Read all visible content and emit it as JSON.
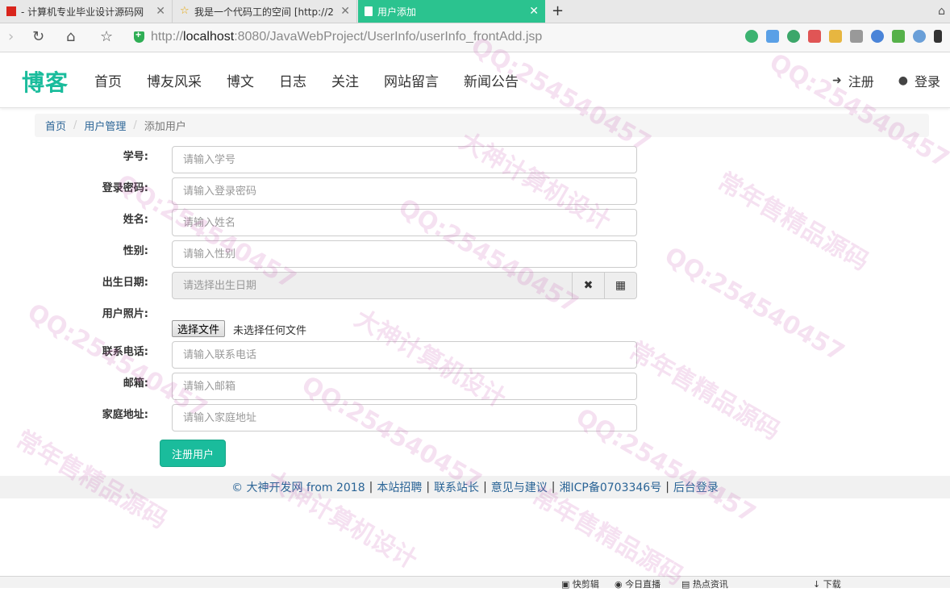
{
  "browser": {
    "tabs": [
      {
        "title": "- 计算机专业毕业设计源码网"
      },
      {
        "title": "我是一个代码工的空间 [http://2"
      },
      {
        "title": "用户添加"
      }
    ],
    "url_proto": "http://",
    "url_host": "localhost",
    "url_rest": ":8080/JavaWebProject/UserInfo/userInfo_frontAdd.jsp"
  },
  "site": {
    "brand": "博客",
    "menu": [
      "首页",
      "博友风采",
      "博文",
      "日志",
      "关注",
      "网站留言",
      "新闻公告"
    ],
    "register": "注册",
    "login": "登录"
  },
  "breadcrumb": {
    "home": "首页",
    "section": "用户管理",
    "current": "添加用户"
  },
  "form": {
    "fields": [
      {
        "label": "学号:",
        "placeholder": "请输入学号"
      },
      {
        "label": "登录密码:",
        "placeholder": "请输入登录密码"
      },
      {
        "label": "姓名:",
        "placeholder": "请输入姓名"
      },
      {
        "label": "性别:",
        "placeholder": "请输入性别"
      }
    ],
    "birth_label": "出生日期:",
    "birth_placeholder": "请选择出生日期",
    "photo_label": "用户照片:",
    "file_button": "选择文件",
    "file_status": "未选择任何文件",
    "fields2": [
      {
        "label": "联系电话:",
        "placeholder": "请输入联系电话"
      },
      {
        "label": "邮箱:",
        "placeholder": "请输入邮箱"
      },
      {
        "label": "家庭地址:",
        "placeholder": "请输入家庭地址"
      }
    ],
    "submit": "注册用户"
  },
  "footer": {
    "copy": "© 大神开发网 from 2018",
    "links": [
      "本站招聘",
      "联系站长",
      "意见与建议",
      "湘ICP备0703346号",
      "后台登录"
    ]
  },
  "statusbar": {
    "items": [
      "快剪辑",
      "今日直播",
      "热点资讯",
      "下载"
    ]
  },
  "watermark": {
    "texts": [
      "QQ:254540457",
      "大神计算机设计",
      "常年售精品源码"
    ]
  },
  "colors": {
    "accent": "#1abc9c",
    "active_tab": "#2bc38f",
    "link": "#2a6496"
  }
}
